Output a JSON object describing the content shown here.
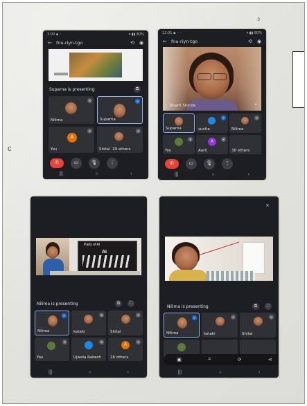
{
  "popup": {
    "label": "F"
  },
  "phones": [
    {
      "id": "p1",
      "meeting_code": "fnu-riyn-tgo",
      "presenting_text": "Suparna is presenting",
      "tiles": [
        {
          "name": "Nilima"
        },
        {
          "name": "Suparna"
        },
        {
          "name": "You",
          "initial": "A"
        },
        {
          "name": "Shital",
          "extra": "29 others"
        }
      ]
    },
    {
      "id": "p2",
      "meeting_code": "fnu-riyn-tgo",
      "presenting_text": "Bharti Shinde",
      "tiles": [
        {
          "name": "Suparna"
        },
        {
          "name": "sunita"
        },
        {
          "name": "Nilima"
        },
        {
          "name": "You"
        },
        {
          "name": "Aarti",
          "initial": "A"
        },
        {
          "name": "30 others"
        }
      ]
    },
    {
      "id": "p3",
      "presenting_text": "Nilima is presenting",
      "slide_title": "Parts of AI",
      "tiles": [
        {
          "name": "Nilima"
        },
        {
          "name": "ketaki"
        },
        {
          "name": "Shital"
        },
        {
          "name": "You"
        },
        {
          "name": "Ujwala Rakesh"
        },
        {
          "name": "26 others",
          "initial": "A"
        }
      ]
    },
    {
      "id": "p4",
      "presenting_text": "Nilima is presenting",
      "tiles": [
        {
          "name": "Nilima"
        },
        {
          "name": "ketaki"
        },
        {
          "name": "Shital"
        }
      ]
    }
  ]
}
